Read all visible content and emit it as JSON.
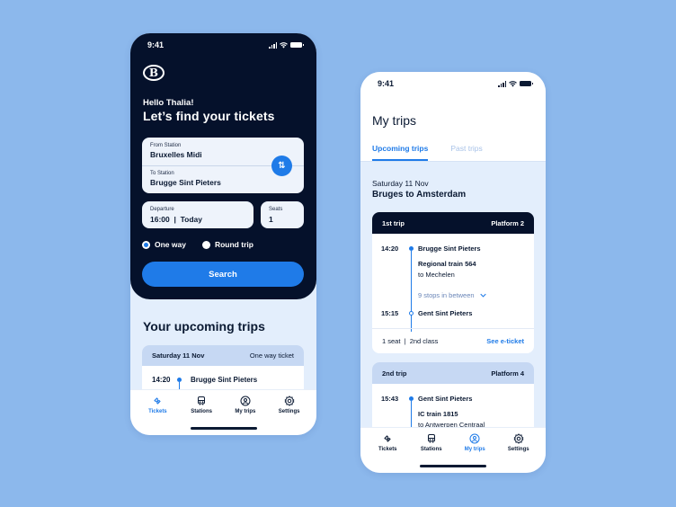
{
  "colors": {
    "background": "#8cb8ec",
    "navy": "#05112b",
    "accent": "#1f7be8",
    "light": "#e3eefc"
  },
  "phone1": {
    "status": {
      "time": "9:41"
    },
    "logo": "B",
    "greeting": "Hello Thalia!",
    "headline": "Let’s find your tickets",
    "from": {
      "label": "From Station",
      "value": "Bruxelles Midi"
    },
    "to": {
      "label": "To Station",
      "value": "Brugge Sint Pieters"
    },
    "swap_icon": "⇅",
    "departure": {
      "label": "Departure",
      "value": "16:00  |  Today"
    },
    "seats": {
      "label": "Seats",
      "value": "1"
    },
    "trip_type": {
      "options": [
        "One way",
        "Round trip"
      ],
      "selected": "One way"
    },
    "search_label": "Search",
    "upcoming": {
      "title": "Your upcoming trips",
      "card": {
        "date": "Saturday 11 Nov",
        "type": "One way ticket",
        "time": "14:20",
        "station": "Brugge Sint Pieters"
      }
    },
    "tabs": [
      {
        "label": "Tickets",
        "icon": "ticket-icon",
        "active": true
      },
      {
        "label": "Stations",
        "icon": "train-icon",
        "active": false
      },
      {
        "label": "My trips",
        "icon": "user-circle-icon",
        "active": false
      },
      {
        "label": "Settings",
        "icon": "gear-icon",
        "active": false
      }
    ]
  },
  "phone2": {
    "status": {
      "time": "9:41"
    },
    "title": "My trips",
    "segments": [
      {
        "label": "Upcoming trips",
        "active": true
      },
      {
        "label": "Past trips",
        "active": false
      }
    ],
    "date": "Saturday 11 Nov",
    "route": "Bruges to Amsterdam",
    "trips": [
      {
        "name": "1st trip",
        "platform": "Platform 2",
        "depart_time": "14:20",
        "depart_station": "Brugge Sint Pieters",
        "train": "Regional train 564",
        "direction": "to Mechelen",
        "stops": "9 stops in between",
        "arrive_time": "15:15",
        "arrive_station": "Gent Sint Pieters",
        "details": "1 seat  |  2nd class",
        "link": "See e-ticket"
      },
      {
        "name": "2nd trip",
        "platform": "Platform 4",
        "depart_time": "15:43",
        "depart_station": "Gent Sint Pieters",
        "train": "IC train 1815",
        "direction": "to Antwerpen Centraal"
      }
    ],
    "tabs": [
      {
        "label": "Tickets",
        "icon": "ticket-icon",
        "active": false
      },
      {
        "label": "Stations",
        "icon": "train-icon",
        "active": false
      },
      {
        "label": "My trips",
        "icon": "user-circle-icon",
        "active": true
      },
      {
        "label": "Settings",
        "icon": "gear-icon",
        "active": false
      }
    ]
  }
}
